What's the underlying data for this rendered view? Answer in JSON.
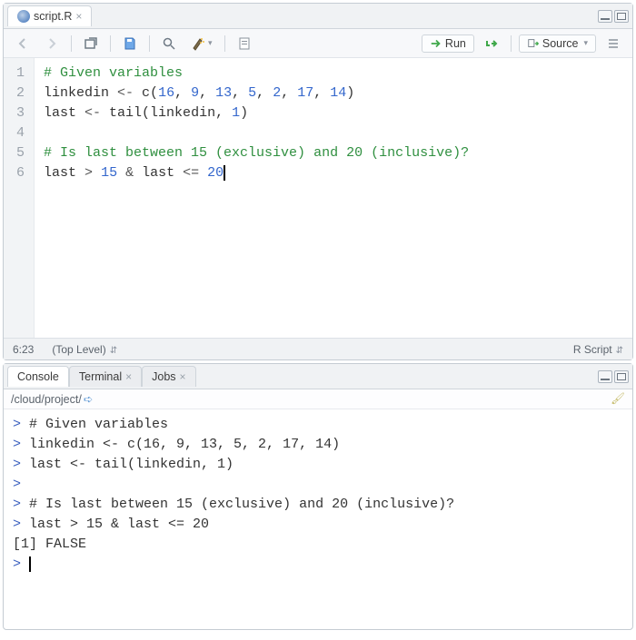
{
  "editor_pane": {
    "tab": {
      "filename": "script.R"
    },
    "toolbar": {
      "run": "Run",
      "source": "Source"
    },
    "code_lines": [
      {
        "n": "1",
        "html": "<span class='com'># Given variables</span>"
      },
      {
        "n": "2",
        "html": "linkedin <span class='op'>&lt;-</span> c(<span class='num'>16</span>, <span class='num'>9</span>, <span class='num'>13</span>, <span class='num'>5</span>, <span class='num'>2</span>, <span class='num'>17</span>, <span class='num'>14</span>)"
      },
      {
        "n": "3",
        "html": "last <span class='op'>&lt;-</span> tail(linkedin, <span class='num'>1</span>)"
      },
      {
        "n": "4",
        "html": ""
      },
      {
        "n": "5",
        "html": "<span class='com'># Is last between 15 (exclusive) and 20 (inclusive)?</span>"
      },
      {
        "n": "6",
        "html": "last <span class='op'>&gt;</span> <span class='num'>15</span> <span class='op'>&amp;</span> last <span class='op'>&lt;=</span> <span class='num'>20</span><span class='cursor'></span>"
      }
    ],
    "status": {
      "pos": "6:23",
      "scope": "(Top Level)",
      "type": "R Script"
    }
  },
  "console_pane": {
    "tabs": {
      "console": "Console",
      "terminal": "Terminal",
      "jobs": "Jobs"
    },
    "path": "/cloud/project/",
    "lines": [
      "<span class='prompt'>&gt;</span> # Given variables",
      "<span class='prompt'>&gt;</span> linkedin &lt;- c(16, 9, 13, 5, 2, 17, 14)",
      "<span class='prompt'>&gt;</span> last &lt;- tail(linkedin, 1)",
      "<span class='prompt'>&gt;</span> ",
      "<span class='prompt'>&gt;</span> # Is last between 15 (exclusive) and 20 (inclusive)?",
      "<span class='prompt'>&gt;</span> last &gt; 15 &amp; last &lt;= 20",
      "[1] FALSE",
      "<span class='prompt'>&gt;</span> <span class='cursor'></span>"
    ]
  }
}
